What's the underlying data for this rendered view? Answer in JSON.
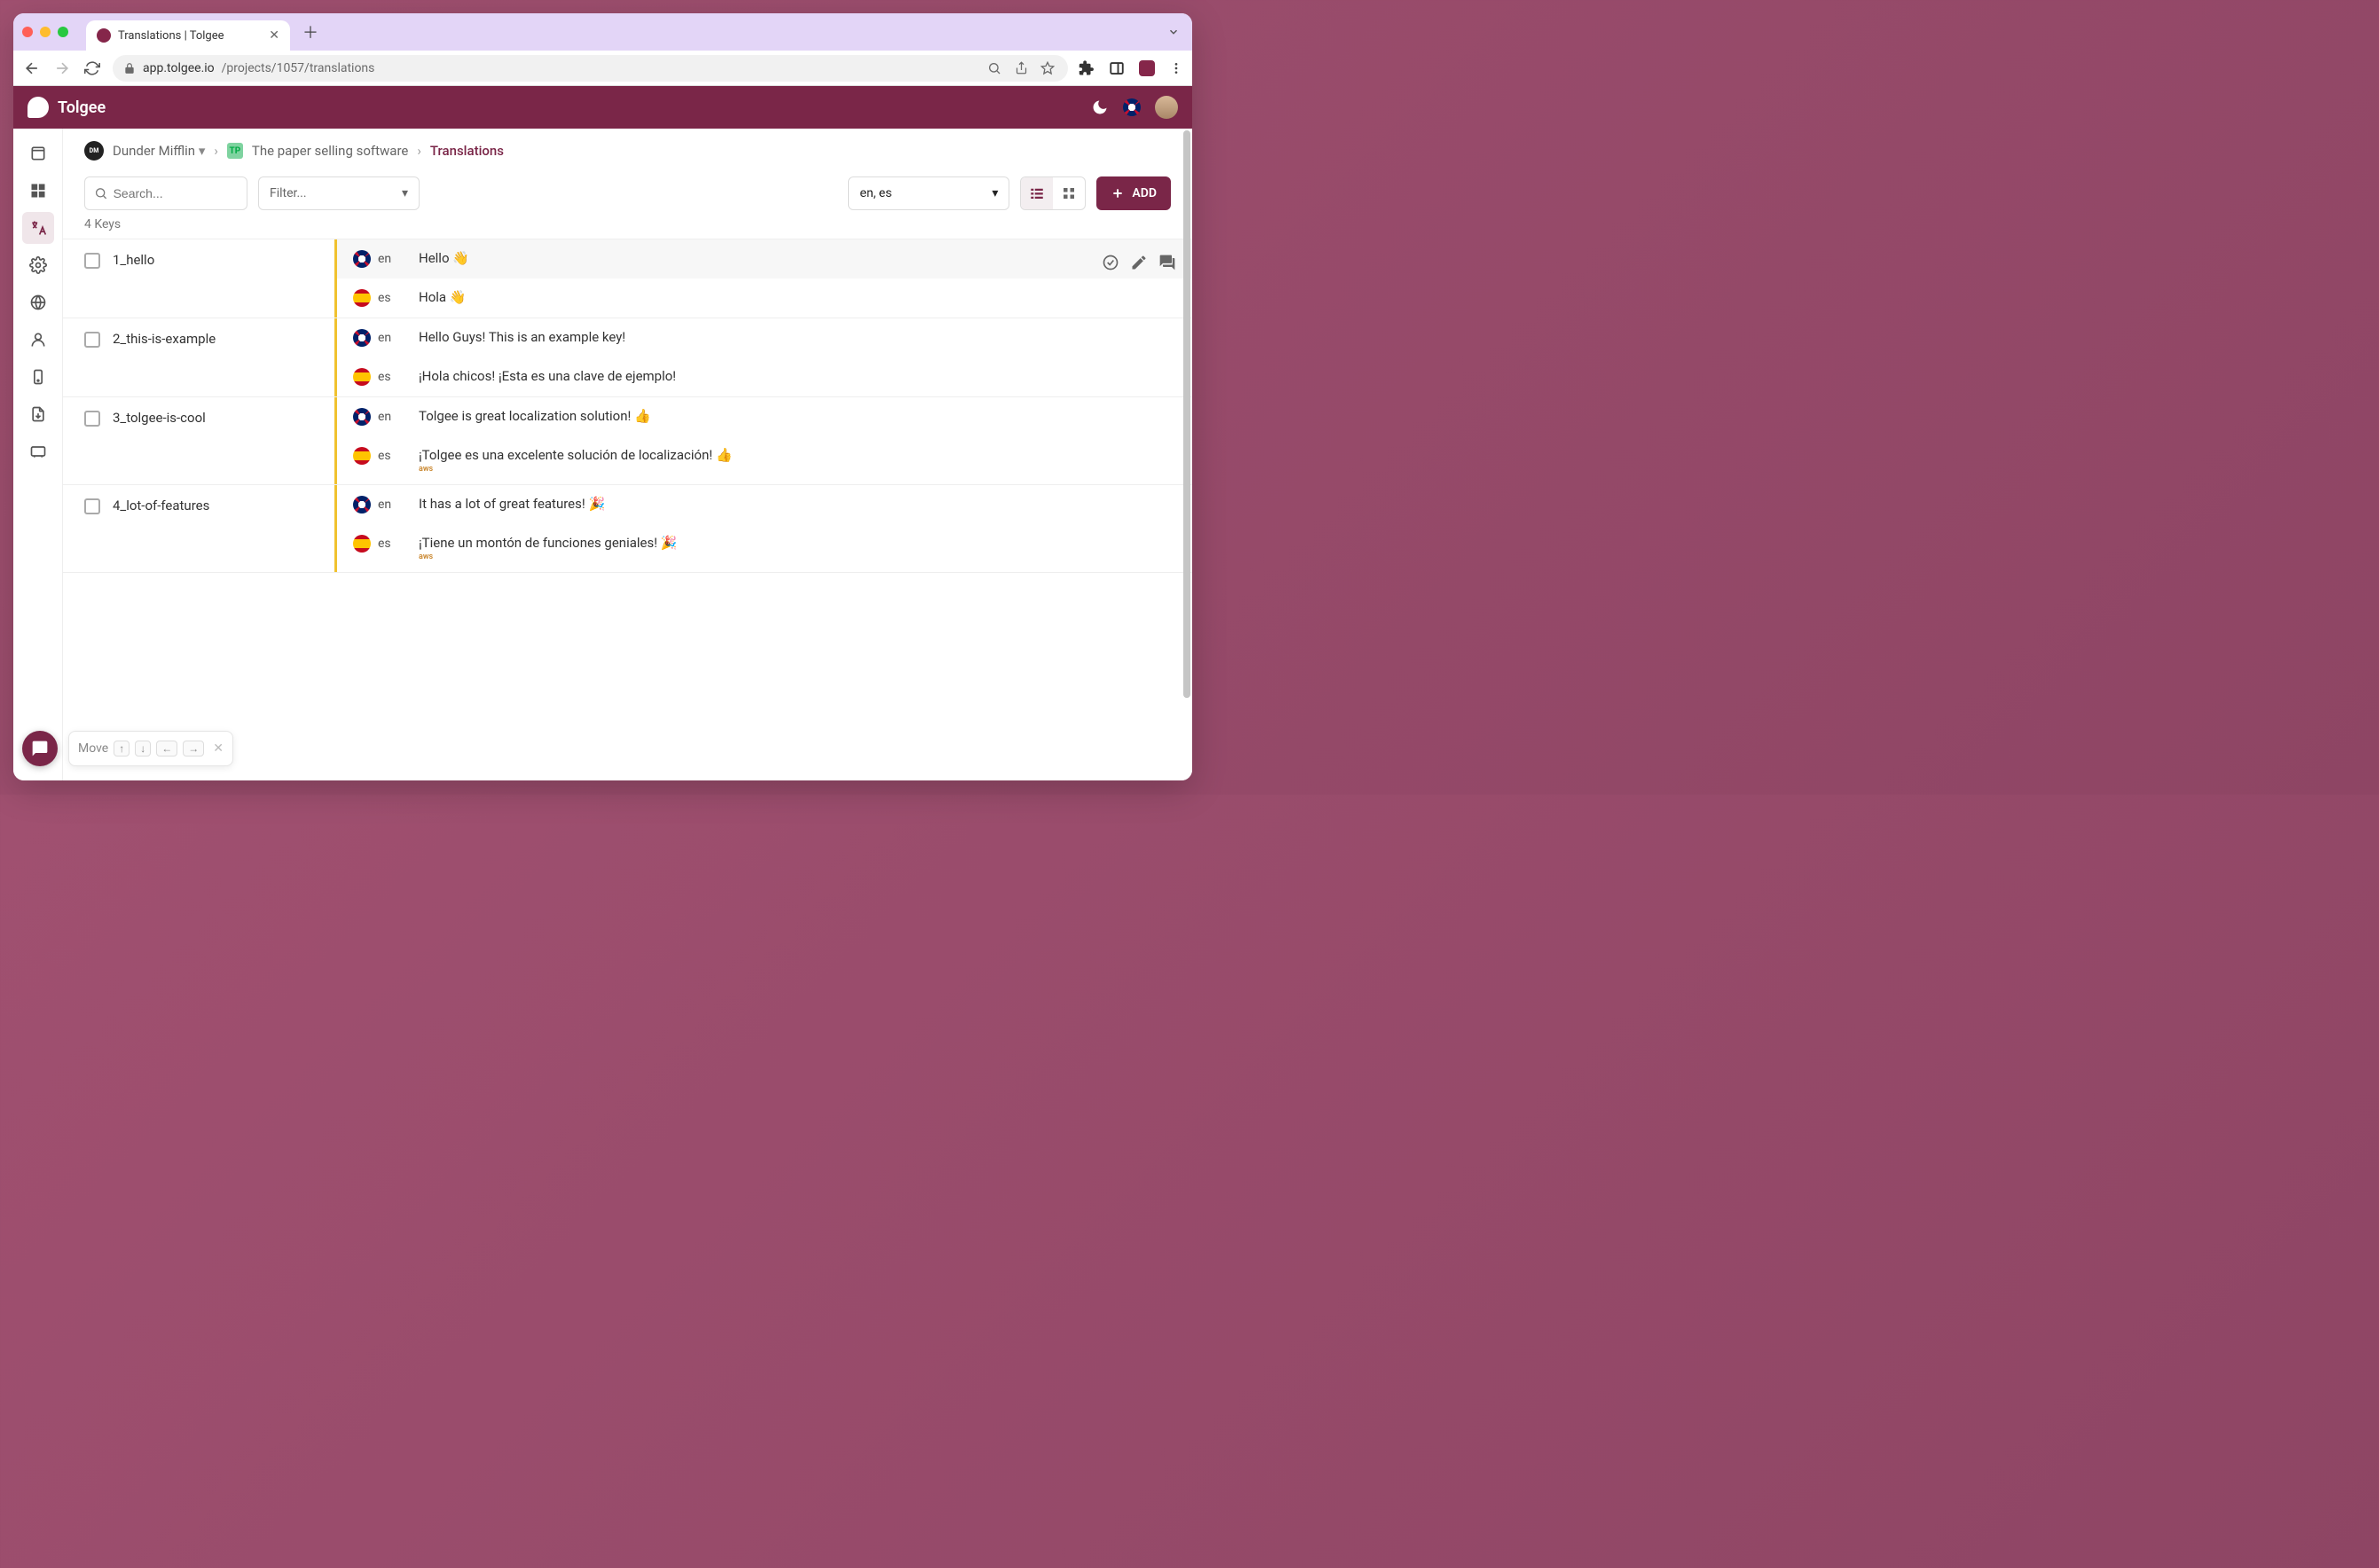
{
  "browser": {
    "tab_title": "Translations | Tolgee",
    "url_host": "app.tolgee.io",
    "url_path": "/projects/1057/translations"
  },
  "header": {
    "brand": "Tolgee"
  },
  "breadcrumb": {
    "org": "Dunder Mifflin",
    "project_badge": "TP",
    "project": "The paper selling software",
    "current": "Translations"
  },
  "toolbar": {
    "search_placeholder": "Search...",
    "filter_label": "Filter...",
    "lang_value": "en, es",
    "add_label": "ADD"
  },
  "keys_count": "4 Keys",
  "langs": {
    "en": "en",
    "es": "es"
  },
  "rows": [
    {
      "key": "1_hello",
      "en": "Hello 👋",
      "es": "Hola 👋",
      "hover": true
    },
    {
      "key": "2_this-is-example",
      "en": "Hello Guys! This is an example key!",
      "es": "¡Hola chicos! ¡Esta es una clave de ejemplo!"
    },
    {
      "key": "3_tolgee-is-cool",
      "en": "Tolgee is great localization solution! 👍",
      "es": "¡Tolgee es una excelente solución de localización! 👍",
      "es_badge": "aws"
    },
    {
      "key": "4_lot-of-features",
      "en": "It has a lot of great features! 🎉",
      "es": "¡Tiene un montón de funciones geniales! 🎉",
      "es_badge": "aws"
    }
  ],
  "move_hint": {
    "label": "Move"
  }
}
